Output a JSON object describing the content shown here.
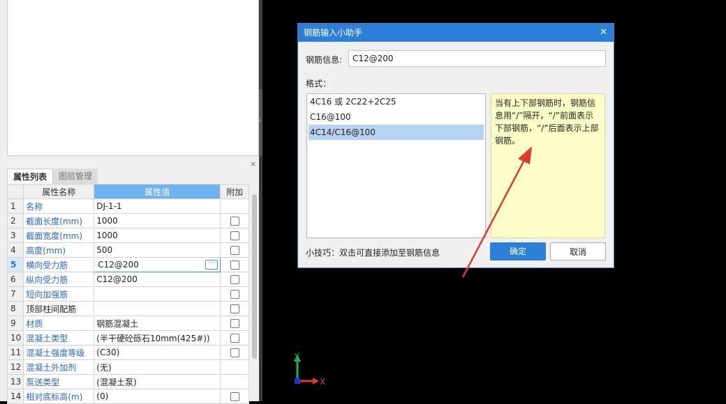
{
  "properties_panel": {
    "tabs": [
      {
        "label": "属性列表",
        "active": true
      },
      {
        "label": "图层管理",
        "active": false
      }
    ],
    "columns": [
      "属性名称",
      "属性值",
      "附加"
    ],
    "rows": [
      {
        "num": "1",
        "name": "名称",
        "value": "DJ-1-1",
        "checkbox": false
      },
      {
        "num": "2",
        "name": "截面长度(mm)",
        "value": "1000",
        "checkbox": true
      },
      {
        "num": "3",
        "name": "截面宽度(mm)",
        "value": "1000",
        "checkbox": true
      },
      {
        "num": "4",
        "name": "高度(mm)",
        "value": "500",
        "checkbox": true
      },
      {
        "num": "5",
        "name": "横向受力筋",
        "value": "C12@200",
        "checkbox": true,
        "selected": true
      },
      {
        "num": "6",
        "name": "纵向受力筋",
        "value": "C12@200",
        "checkbox": true
      },
      {
        "num": "7",
        "name": "短向加强筋",
        "value": "",
        "checkbox": true
      },
      {
        "num": "8",
        "name": "顶部柱间配筋",
        "value": "",
        "checkbox": true,
        "plain": true
      },
      {
        "num": "9",
        "name": "材质",
        "value": "钢筋混凝土",
        "checkbox": true
      },
      {
        "num": "10",
        "name": "混凝土类型",
        "value": "(半干硬砼砾石10mm(425#))",
        "checkbox": true
      },
      {
        "num": "11",
        "name": "混凝土强度等级",
        "value": "(C30)",
        "checkbox": true
      },
      {
        "num": "12",
        "name": "混凝土外加剂",
        "value": "(无)",
        "checkbox": false
      },
      {
        "num": "13",
        "name": "泵送类型",
        "value": "(混凝土泵)",
        "checkbox": false
      },
      {
        "num": "14",
        "name": "相对底标高(m)",
        "value": "(0)",
        "checkbox": true
      }
    ]
  },
  "dialog": {
    "title": "钢筋输入小助手",
    "info_label": "钢筋信息:",
    "info_value": "C12@200",
    "format_label": "格式：",
    "formats": [
      "4C16 或 2C22+2C25",
      "C16@100",
      "4C14/C16@100"
    ],
    "selected_format": 2,
    "hint": "当有上下部钢筋时，钢筋信息用“/”隔开，“/”前面表示下部钢筋，“/”后面表示上部钢筋。",
    "tip": "小技巧：双击可直接添加至钢筋信息",
    "ok_label": "确定",
    "cancel_label": "取消"
  },
  "axes": {
    "y_label": "Y",
    "x_label": "X"
  },
  "colors": {
    "title_bar": "#2d7ed7",
    "hint_bg": "#ffffc8",
    "annotation_arrow": "#e0392b",
    "axis_x": "#e0392b",
    "axis_y": "#22b14c"
  }
}
